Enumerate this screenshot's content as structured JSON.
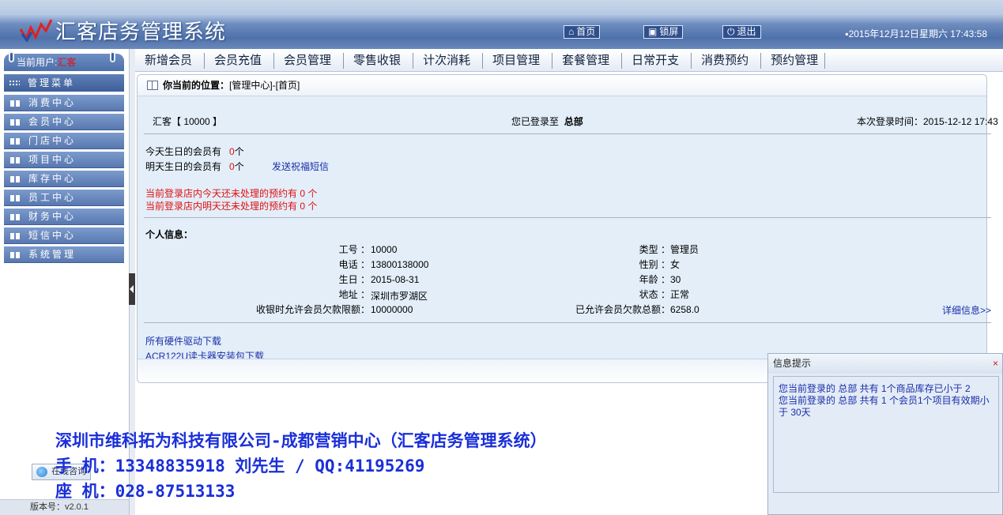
{
  "header": {
    "logo_text": "汇客店务管理系统",
    "buttons": {
      "home": "首页",
      "lock": "锁屏",
      "logout": "退出"
    },
    "datetime": "2015年12月12日星期六  17:43:58"
  },
  "sidebar": {
    "current_user_label": "当前用户:",
    "current_user": "汇客",
    "menu_title": "管理菜单",
    "items": [
      {
        "label": "消费中心"
      },
      {
        "label": "会员中心"
      },
      {
        "label": "门店中心"
      },
      {
        "label": "项目中心"
      },
      {
        "label": "库存中心"
      },
      {
        "label": "员工中心"
      },
      {
        "label": "财务中心"
      },
      {
        "label": "短信中心"
      },
      {
        "label": "系统管理"
      }
    ],
    "online_consult": "在线咨询",
    "version": "版本号：v2.0.1"
  },
  "nav": [
    "新增会员",
    "会员充值",
    "会员管理",
    "零售收银",
    "计次消耗",
    "项目管理",
    "套餐管理",
    "日常开支",
    "消费预约",
    "预约管理"
  ],
  "breadcrumb": {
    "label": "你当前的位置：",
    "path": "[管理中心]-[首页]"
  },
  "main": {
    "store_label": "汇客【 10000 】",
    "login_to_label": "您已登录至",
    "login_to_value": "总部",
    "login_time": "本次登录时间：2015-12-12 17:43",
    "birthday_today_prefix": "今天生日的会员有",
    "birthday_today_count": "0",
    "birthday_unit": "个",
    "birthday_tomorrow_prefix": "明天生日的会员有",
    "birthday_tomorrow_count": "0",
    "send_sms": "发送祝福短信",
    "appt_today": "当前登录店内今天还未处理的预约有  0  个",
    "appt_tomorrow": "当前登录店内明天还未处理的预约有  0  个",
    "personal_title": "个人信息：",
    "info_left": [
      {
        "label": "工号 ：",
        "value": "10000"
      },
      {
        "label": "电话 ：",
        "value": "13800138000"
      },
      {
        "label": "生日 ：",
        "value": "2015-08-31"
      },
      {
        "label": "地址 ：",
        "value": "深圳市罗湖区"
      },
      {
        "label": "收银时允许会员欠款限额：",
        "value": "10000000"
      }
    ],
    "info_right": [
      {
        "label": "类型 ：",
        "value": "管理员"
      },
      {
        "label": "性别 ：",
        "value": "女"
      },
      {
        "label": "年龄 ：",
        "value": "30"
      },
      {
        "label": "状态 ：",
        "value": "正常"
      },
      {
        "label": "已允许会员欠款总额：",
        "value": "6258.0"
      }
    ],
    "detail_link": "详细信息>>",
    "download_drivers": "所有硬件驱动下载",
    "download_acr": "ACR122U读卡器安装包下载"
  },
  "popup": {
    "title": "信息提示",
    "close": "×",
    "line1": "您当前登录的 总部 共有 1个商品库存已小于 2",
    "line2": "您当前登录的 总部 共有 1 个会员1个项目有效期小于 30天"
  },
  "ad": {
    "line1": "深圳市维科拓为科技有限公司-成都营销中心（汇客店务管理系统）",
    "line2": "手 机：13348835918 刘先生 / QQ:41195269",
    "line3": "座 机：028-87513133"
  }
}
